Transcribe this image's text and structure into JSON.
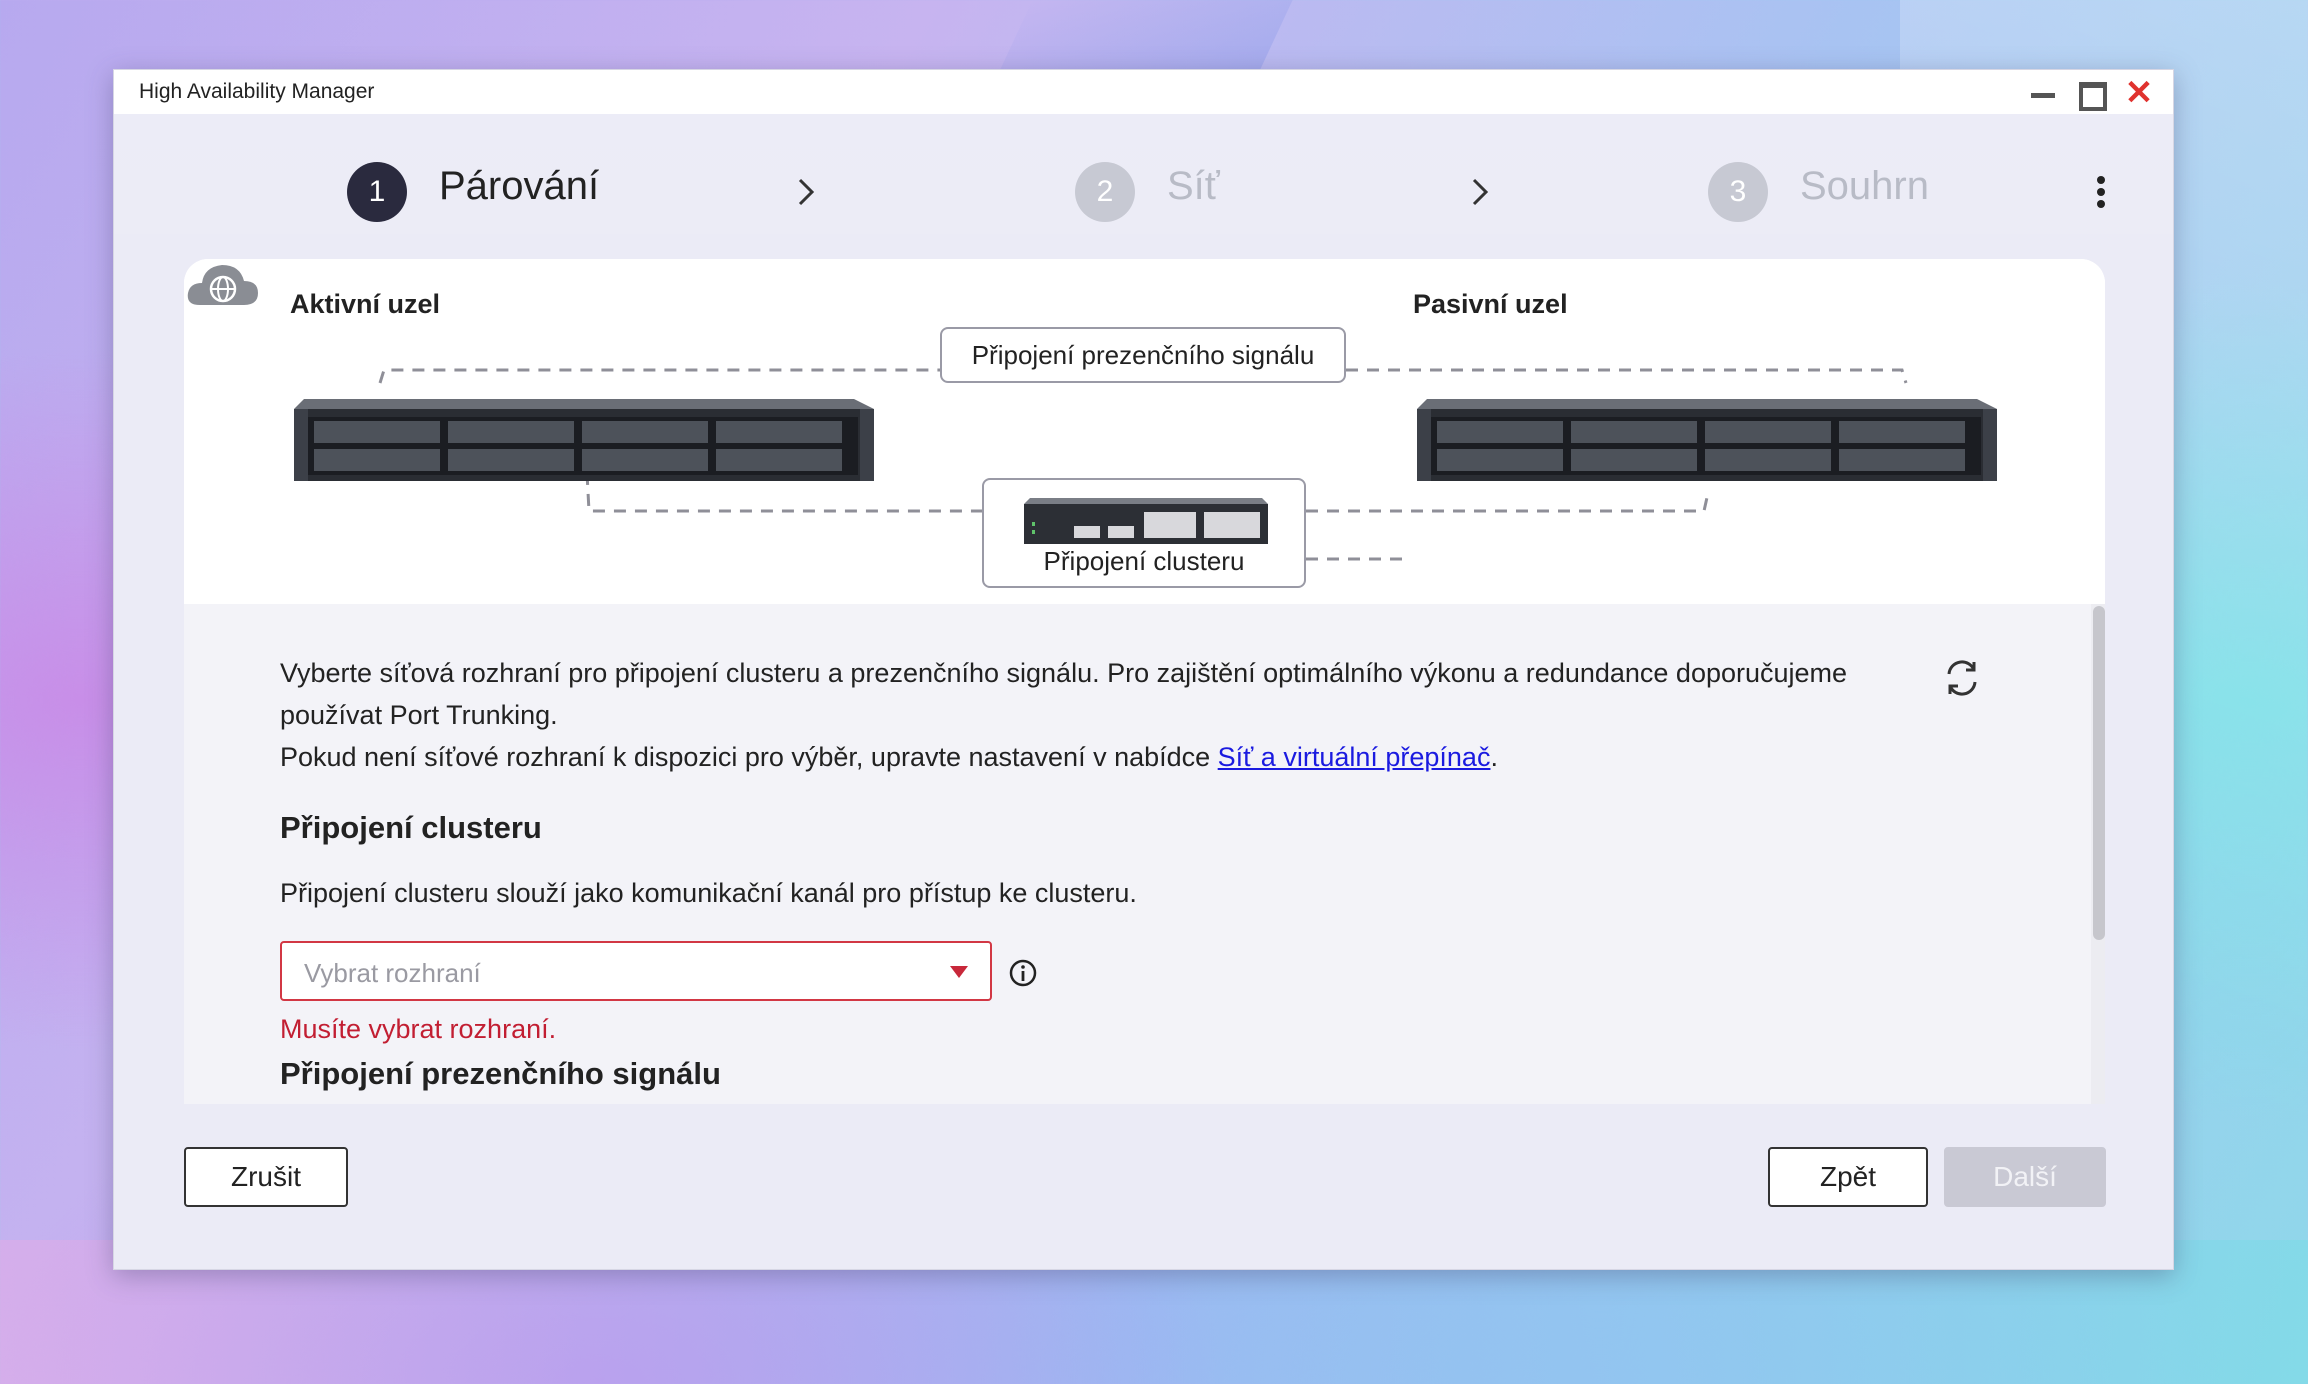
{
  "window": {
    "title": "High Availability Manager"
  },
  "steps": [
    {
      "number": "1",
      "label": "Párování",
      "state": "active"
    },
    {
      "number": "2",
      "label": "Síť",
      "state": "inactive"
    },
    {
      "number": "3",
      "label": "Souhrn",
      "state": "inactive"
    }
  ],
  "diagram": {
    "active_node": "Aktivní uzel",
    "passive_node": "Pasivní uzel",
    "heartbeat_label": "Připojení prezenčního signálu",
    "cluster_label": "Připojení clusteru"
  },
  "content": {
    "description_1": "Vyberte síťová rozhraní pro připojení clusteru a prezenčního signálu. Pro zajištění optimálního výkonu a redundance doporučujeme používat Port Trunking.",
    "description_2_prefix": "Pokud není síťové rozhraní k dispozici pro výběr, upravte nastavení v nabídce ",
    "description_2_link": "Síť a virtuální přepínač",
    "description_2_suffix": ".",
    "cluster_heading": "Připojení clusteru",
    "cluster_text": "Připojení clusteru slouží jako komunikační kanál pro přístup ke clusteru.",
    "select_placeholder": "Vybrat rozhraní",
    "error_text": "Musíte vybrat rozhraní.",
    "heartbeat_heading": "Připojení prezenčního signálu"
  },
  "buttons": {
    "cancel": "Zrušit",
    "back": "Zpět",
    "next": "Další"
  },
  "colors": {
    "accent_dark": "#2a2a3e",
    "error": "#c21e32",
    "link": "#1a1ae0",
    "close": "#e0322e"
  },
  "icons": [
    "minimize-icon",
    "maximize-icon",
    "close-icon",
    "chevron-right-icon",
    "kebab-menu-icon",
    "refresh-icon",
    "info-icon",
    "globe-cloud-icon",
    "network-switch-icon",
    "nas-server-icon"
  ]
}
